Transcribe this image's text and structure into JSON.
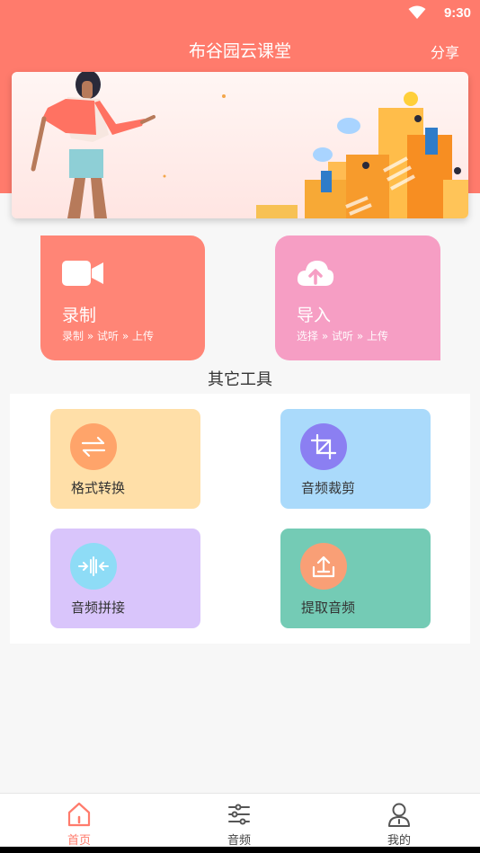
{
  "status": {
    "time": "9:30"
  },
  "header": {
    "title": "布谷园云课堂",
    "share_label": "分享"
  },
  "colors": {
    "brand": "#ff7b6c",
    "record_card": "#ff8576",
    "import_card": "#f69ec4"
  },
  "cards": {
    "record": {
      "title": "录制",
      "steps": [
        "录制",
        "试听",
        "上传"
      ],
      "icon": "video-camera-icon"
    },
    "import": {
      "title": "导入",
      "steps": [
        "选择",
        "试听",
        "上传"
      ],
      "icon": "cloud-upload-icon"
    }
  },
  "tools": {
    "title": "其它工具",
    "items": [
      {
        "label": "格式转换",
        "icon": "convert-arrows-icon"
      },
      {
        "label": "音频裁剪",
        "icon": "crop-icon"
      },
      {
        "label": "音频拼接",
        "icon": "merge-audio-icon"
      },
      {
        "label": "提取音频",
        "icon": "extract-upload-icon"
      }
    ]
  },
  "nav": {
    "items": [
      {
        "label": "首页",
        "icon": "home-icon",
        "active": true
      },
      {
        "label": "音频",
        "icon": "sliders-icon",
        "active": false
      },
      {
        "label": "我的",
        "icon": "user-icon",
        "active": false
      }
    ]
  }
}
